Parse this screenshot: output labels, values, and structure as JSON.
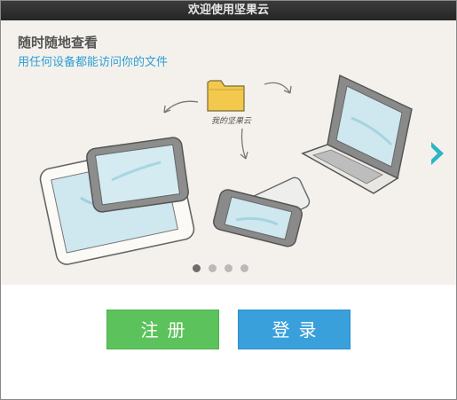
{
  "window": {
    "title": "欢迎使用坚果云"
  },
  "slide": {
    "headline": "随时随地查看",
    "subline": "用任何设备都能访问你的文件",
    "folder_label": "我的坚果云",
    "page_count": 4,
    "active_page": 1
  },
  "buttons": {
    "register_label": "注册",
    "login_label": "登录"
  },
  "colors": {
    "accent_blue": "#3aa0dc",
    "register_green": "#5cc35c",
    "next_arrow": "#2bb5c8"
  },
  "icons": {
    "next": "chevron-right-icon",
    "folder": "folder-icon"
  }
}
